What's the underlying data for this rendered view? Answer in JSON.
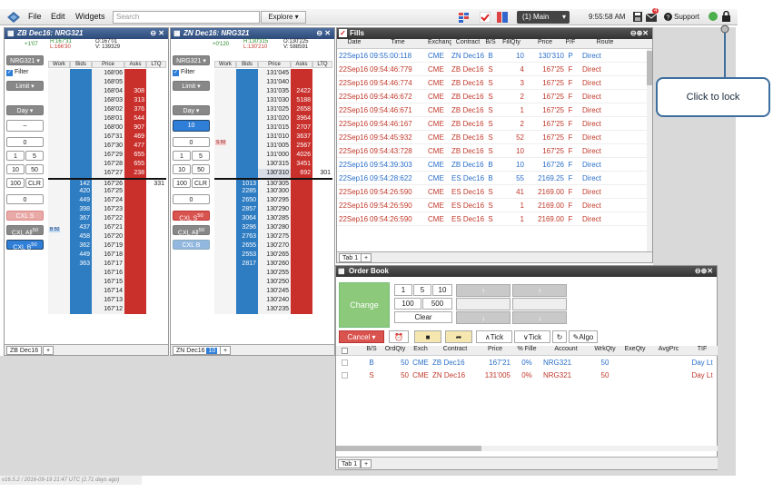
{
  "topbar": {
    "menus": [
      "File",
      "Edit",
      "Widgets"
    ],
    "search_placeholder": "Search",
    "explore": "Explore",
    "workspace": "(1) Main",
    "clock": "9:55:58 AM",
    "support": "Support",
    "mail_badge": "4",
    "icons": [
      "logo-icon",
      "grid-icon",
      "check-icon",
      "layout-icon",
      "save-icon",
      "mail-icon",
      "help-icon",
      "status-dot-icon",
      "lock-icon"
    ],
    "accent": "#2c4a7a"
  },
  "ladder1": {
    "title": "ZB Dec16: NRG321",
    "change": "+1'07",
    "high": "H:167'31",
    "low": "L:166'30",
    "open": "O:167'01",
    "volume": "V: 139329",
    "account": "NRG321",
    "filter": "Filter",
    "limit": "Limit",
    "day": "Day",
    "qty_field": "–",
    "pos_field": "0",
    "btns": [
      "1",
      "5",
      "10",
      "50",
      "100",
      "CLR"
    ],
    "zero": "0",
    "cxl_s": "CXL S",
    "cxl_all": "CXL All",
    "cxl_all_sup": "50",
    "cxl_b": "CXL B",
    "cxl_b_sup": "50",
    "cols": [
      "Work",
      "Bids",
      "Price",
      "Asks",
      "LTQ"
    ],
    "side_note": "B 50",
    "tab": "ZB Dec16",
    "rows": [
      {
        "p": "168'06",
        "a": "",
        "b": "",
        "l": ""
      },
      {
        "p": "168'05",
        "a": "",
        "b": "",
        "l": ""
      },
      {
        "p": "168'04",
        "a": "308",
        "b": "",
        "l": ""
      },
      {
        "p": "168'03",
        "a": "313",
        "b": "",
        "l": ""
      },
      {
        "p": "168'02",
        "a": "376",
        "b": "",
        "l": ""
      },
      {
        "p": "168'01",
        "a": "544",
        "b": "",
        "l": ""
      },
      {
        "p": "168'00",
        "a": "907",
        "b": "",
        "l": ""
      },
      {
        "p": "167'31",
        "a": "469",
        "b": "",
        "l": ""
      },
      {
        "p": "167'30",
        "a": "477",
        "b": "",
        "l": ""
      },
      {
        "p": "167'29",
        "a": "655",
        "b": "",
        "l": ""
      },
      {
        "p": "167'28",
        "a": "655",
        "b": "",
        "l": ""
      },
      {
        "p": "167'27",
        "a": "238",
        "b": "",
        "l": ""
      },
      {
        "p": "167'26",
        "a": "",
        "b": "142",
        "l": "331"
      },
      {
        "p": "167'25",
        "a": "",
        "b": "420",
        "l": ""
      },
      {
        "p": "167'24",
        "a": "",
        "b": "449",
        "l": ""
      },
      {
        "p": "167'23",
        "a": "",
        "b": "398",
        "l": ""
      },
      {
        "p": "167'22",
        "a": "",
        "b": "367",
        "l": ""
      },
      {
        "p": "167'21",
        "a": "",
        "b": "437",
        "l": ""
      },
      {
        "p": "167'20",
        "a": "",
        "b": "458",
        "l": ""
      },
      {
        "p": "167'19",
        "a": "",
        "b": "362",
        "l": ""
      },
      {
        "p": "167'18",
        "a": "",
        "b": "449",
        "l": ""
      },
      {
        "p": "167'17",
        "a": "",
        "b": "363",
        "l": ""
      },
      {
        "p": "167'16",
        "a": "",
        "b": "",
        "l": ""
      },
      {
        "p": "167'15",
        "a": "",
        "b": "",
        "l": ""
      },
      {
        "p": "167'14",
        "a": "",
        "b": "",
        "l": ""
      },
      {
        "p": "167'13",
        "a": "",
        "b": "",
        "l": ""
      },
      {
        "p": "167'12",
        "a": "",
        "b": "",
        "l": ""
      }
    ]
  },
  "ladder2": {
    "title": "ZN Dec16: NRG321",
    "change": "+0'120",
    "high": "H:130'315",
    "low": "L:130'210",
    "open": "O:130'225",
    "volume": "V: 588591",
    "account": "NRG321",
    "filter": "Filter",
    "limit": "Limit",
    "day": "Day",
    "qty_field": "10",
    "pos_field": "0",
    "btns": [
      "1",
      "5",
      "10",
      "50",
      "100",
      "CLR"
    ],
    "zero": "0",
    "cxl_s": "CXL S",
    "cxl_s_sup": "50",
    "cxl_all": "CXL All",
    "cxl_all_sup": "50",
    "cxl_b": "CXL B",
    "cols": [
      "Work",
      "Bids",
      "Price",
      "Asks",
      "LTQ"
    ],
    "side_note": "S 50",
    "tab": "ZN Dec16",
    "tab_badge": "10",
    "rows": [
      {
        "p": "131'045",
        "a": "",
        "b": "",
        "l": ""
      },
      {
        "p": "131'040",
        "a": "",
        "b": "",
        "l": ""
      },
      {
        "p": "131'035",
        "a": "2422",
        "b": "",
        "l": ""
      },
      {
        "p": "131'030",
        "a": "5188",
        "b": "",
        "l": ""
      },
      {
        "p": "131'025",
        "a": "2658",
        "b": "",
        "l": ""
      },
      {
        "p": "131'020",
        "a": "3964",
        "b": "",
        "l": ""
      },
      {
        "p": "131'015",
        "a": "2707",
        "b": "",
        "l": ""
      },
      {
        "p": "131'010",
        "a": "3637",
        "b": "",
        "l": ""
      },
      {
        "p": "131'005",
        "a": "2567",
        "b": "",
        "l": ""
      },
      {
        "p": "131'000",
        "a": "4026",
        "b": "",
        "l": ""
      },
      {
        "p": "130'315",
        "a": "3451",
        "b": "",
        "l": ""
      },
      {
        "p": "130'310",
        "a": "692",
        "b": "",
        "l": "301"
      },
      {
        "p": "130'305",
        "a": "",
        "b": "1013",
        "l": ""
      },
      {
        "p": "130'300",
        "a": "",
        "b": "2285",
        "l": ""
      },
      {
        "p": "130'295",
        "a": "",
        "b": "2650",
        "l": ""
      },
      {
        "p": "130'290",
        "a": "",
        "b": "2857",
        "l": ""
      },
      {
        "p": "130'285",
        "a": "",
        "b": "3064",
        "l": ""
      },
      {
        "p": "130'280",
        "a": "",
        "b": "3296",
        "l": ""
      },
      {
        "p": "130'275",
        "a": "",
        "b": "2763",
        "l": ""
      },
      {
        "p": "130'270",
        "a": "",
        "b": "2655",
        "l": ""
      },
      {
        "p": "130'265",
        "a": "",
        "b": "2553",
        "l": ""
      },
      {
        "p": "130'260",
        "a": "",
        "b": "2817",
        "l": ""
      },
      {
        "p": "130'255",
        "a": "",
        "b": "",
        "l": ""
      },
      {
        "p": "130'250",
        "a": "",
        "b": "",
        "l": ""
      },
      {
        "p": "130'245",
        "a": "",
        "b": "",
        "l": ""
      },
      {
        "p": "130'240",
        "a": "",
        "b": "",
        "l": ""
      },
      {
        "p": "130'235",
        "a": "",
        "b": "",
        "l": ""
      }
    ]
  },
  "fills": {
    "title": "Fills",
    "cols": [
      "Date",
      "Time",
      "Exchang",
      "Contract",
      "B/S",
      "FillQty",
      "Price",
      "P/F",
      "Route"
    ],
    "tab": "Tab 1",
    "rows": [
      {
        "date": "22Sep16",
        "time": "09:55:00:118",
        "exch": "CME",
        "contract": "ZN Dec16",
        "bs": "B",
        "qty": "10",
        "price": "130'310",
        "pf": "P",
        "route": "Direct",
        "color": "blue"
      },
      {
        "date": "22Sep16",
        "time": "09:54:46:779",
        "exch": "CME",
        "contract": "ZB Dec16",
        "bs": "S",
        "qty": "4",
        "price": "167'25",
        "pf": "F",
        "route": "Direct",
        "color": "red"
      },
      {
        "date": "22Sep16",
        "time": "09:54:46:774",
        "exch": "CME",
        "contract": "ZB Dec16",
        "bs": "S",
        "qty": "3",
        "price": "167'25",
        "pf": "F",
        "route": "Direct",
        "color": "red"
      },
      {
        "date": "22Sep16",
        "time": "09:54:46:672",
        "exch": "CME",
        "contract": "ZB Dec16",
        "bs": "S",
        "qty": "2",
        "price": "167'25",
        "pf": "F",
        "route": "Direct",
        "color": "red"
      },
      {
        "date": "22Sep16",
        "time": "09:54:46:671",
        "exch": "CME",
        "contract": "ZB Dec16",
        "bs": "S",
        "qty": "1",
        "price": "167'25",
        "pf": "F",
        "route": "Direct",
        "color": "red"
      },
      {
        "date": "22Sep16",
        "time": "09:54:46:167",
        "exch": "CME",
        "contract": "ZB Dec16",
        "bs": "S",
        "qty": "2",
        "price": "167'25",
        "pf": "F",
        "route": "Direct",
        "color": "red"
      },
      {
        "date": "22Sep16",
        "time": "09:54:45:932",
        "exch": "CME",
        "contract": "ZB Dec16",
        "bs": "S",
        "qty": "52",
        "price": "167'25",
        "pf": "F",
        "route": "Direct",
        "color": "red"
      },
      {
        "date": "22Sep16",
        "time": "09:54:43:728",
        "exch": "CME",
        "contract": "ZB Dec16",
        "bs": "S",
        "qty": "10",
        "price": "167'25",
        "pf": "F",
        "route": "Direct",
        "color": "red"
      },
      {
        "date": "22Sep16",
        "time": "09:54:39:303",
        "exch": "CME",
        "contract": "ZB Dec16",
        "bs": "B",
        "qty": "10",
        "price": "167'26",
        "pf": "F",
        "route": "Direct",
        "color": "blue"
      },
      {
        "date": "22Sep16",
        "time": "09:54:28:622",
        "exch": "CME",
        "contract": "ES Dec16",
        "bs": "B",
        "qty": "55",
        "price": "2169.25",
        "pf": "F",
        "route": "Direct",
        "color": "blue"
      },
      {
        "date": "22Sep16",
        "time": "09:54:26:590",
        "exch": "CME",
        "contract": "ES Dec16",
        "bs": "S",
        "qty": "41",
        "price": "2169.00",
        "pf": "F",
        "route": "Direct",
        "color": "red"
      },
      {
        "date": "22Sep16",
        "time": "09:54:26:590",
        "exch": "CME",
        "contract": "ES Dec16",
        "bs": "S",
        "qty": "1",
        "price": "2169.00",
        "pf": "F",
        "route": "Direct",
        "color": "red"
      },
      {
        "date": "22Sep16",
        "time": "09:54:26:590",
        "exch": "CME",
        "contract": "ES Dec16",
        "bs": "S",
        "qty": "1",
        "price": "2169.00",
        "pf": "F",
        "route": "Direct",
        "color": "red"
      }
    ]
  },
  "orderbook": {
    "title": "Order Book",
    "change": "Change",
    "qty_btns": [
      "1",
      "5",
      "10",
      "100",
      "500"
    ],
    "clear": "Clear",
    "cancel": "Cancel",
    "tick_up": "Tick",
    "tick_down": "Tick",
    "algo": "Algo",
    "tab": "Tab 1",
    "cols": [
      "B/S",
      "OrdQty",
      "Exch",
      "Contract",
      "Price",
      "% Fille",
      "Account",
      "WrkQty",
      "ExeQty",
      "AvgPrc",
      "TIF"
    ],
    "rows": [
      {
        "bs": "B",
        "qty": "50",
        "exch": "CME",
        "contract": "ZB Dec16",
        "price": "167'21",
        "pct": "0%",
        "account": "NRG321",
        "wrk": "50",
        "tif": "Day Lt",
        "color": "blue"
      },
      {
        "bs": "S",
        "qty": "50",
        "exch": "CME",
        "contract": "ZN Dec16",
        "price": "131'005",
        "pct": "0%",
        "account": "NRG321",
        "wrk": "50",
        "tif": "Day Lt",
        "color": "red"
      }
    ]
  },
  "tooltip": "Click to lock",
  "status": "v16.5.2 / 2016-09-19 21:47 UTC (2.71 days ago)"
}
